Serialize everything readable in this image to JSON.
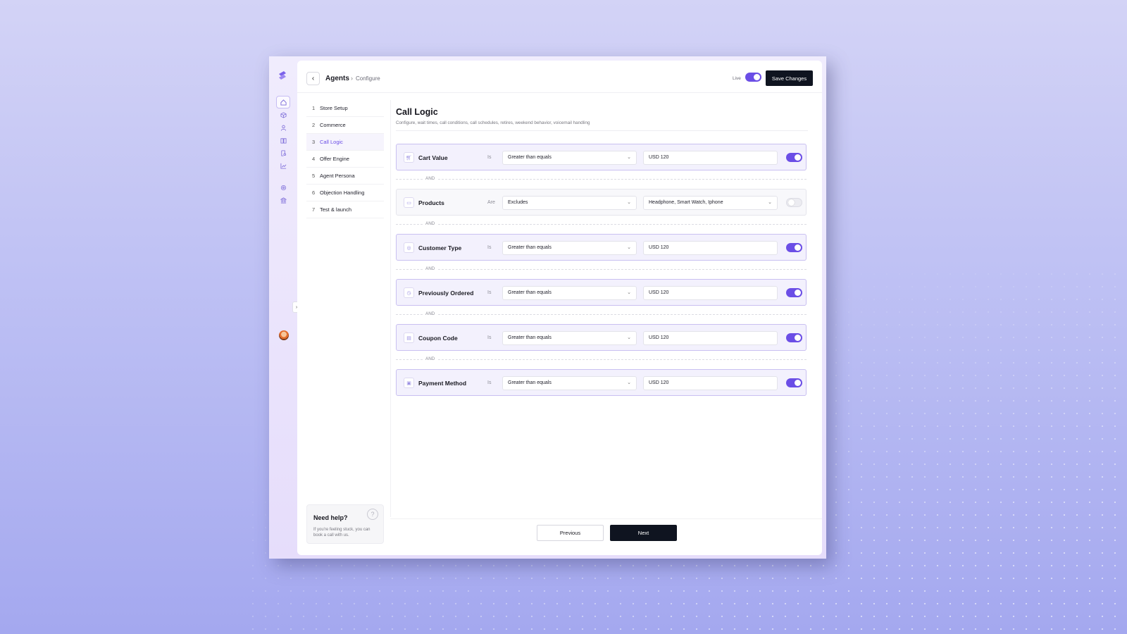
{
  "breadcrumb": {
    "main": "Agents",
    "separator": "›",
    "current": "Configure"
  },
  "header": {
    "live_label": "Live",
    "live_enabled": true,
    "save_label": "Save Changes"
  },
  "steps": [
    {
      "num": "1",
      "label": "Store Setup"
    },
    {
      "num": "2",
      "label": "Commerce"
    },
    {
      "num": "3",
      "label": "Call Logic"
    },
    {
      "num": "4",
      "label": "Offer Engine"
    },
    {
      "num": "5",
      "label": "Agent Persona"
    },
    {
      "num": "6",
      "label": "Objection Handling"
    },
    {
      "num": "7",
      "label": "Test & launch"
    }
  ],
  "active_step": "Call Logic",
  "help": {
    "title": "Need help?",
    "description": "If you're feeling stuck, you can book a call with us.",
    "icon": "?"
  },
  "main": {
    "title": "Call Logic",
    "subtitle": "Configure, wait times, call conditions, call schedules, retires, weekend behavior, voicemail handling"
  },
  "connector": "AND",
  "conditions": [
    {
      "label": "Cart Value",
      "icon": "cart-icon",
      "verb": "Is",
      "operator": "Greater than equals",
      "value": "USD 120",
      "enabled": true
    },
    {
      "label": "Products",
      "icon": "folder-icon",
      "verb": "Are",
      "operator": "Excludes",
      "value": "Headphone, Smart Watch, Iphone",
      "enabled": false
    },
    {
      "label": "Customer Type",
      "icon": "globe-icon",
      "verb": "Is",
      "operator": "Greater than equals",
      "value": "USD 120",
      "enabled": true
    },
    {
      "label": "Previously Ordered",
      "icon": "clock-icon",
      "verb": "Is",
      "operator": "Greater than equals",
      "value": "USD 120",
      "enabled": true
    },
    {
      "label": "Coupon Code",
      "icon": "ticket-icon",
      "verb": "Is",
      "operator": "Greater than equals",
      "value": "USD 120",
      "enabled": true
    },
    {
      "label": "Payment Method",
      "icon": "card-icon",
      "verb": "Is",
      "operator": "Greater than equals",
      "value": "USD 120",
      "enabled": true
    }
  ],
  "footer": {
    "previous_label": "Previous",
    "next_label": "Next"
  },
  "colors": {
    "accent": "#6b4ee6",
    "dark": "#0f1420",
    "active_row": "#f3f1fd"
  }
}
